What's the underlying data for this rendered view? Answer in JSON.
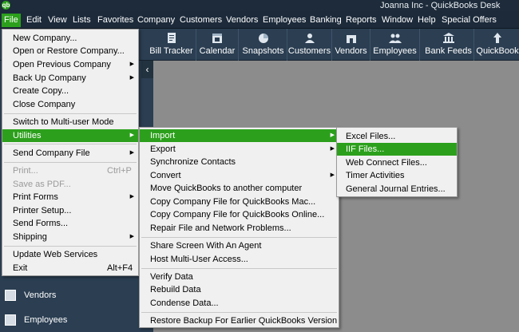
{
  "window": {
    "title": "Joanna Inc  -  QuickBooks Desk",
    "logo": "qb"
  },
  "menubar": {
    "items": [
      "File",
      "Edit",
      "View",
      "Lists",
      "Favorites",
      "Company",
      "Customers",
      "Vendors",
      "Employees",
      "Banking",
      "Reports",
      "Window",
      "Help",
      "Special Offers"
    ]
  },
  "iconbar": {
    "items": [
      {
        "label": "Bill Tracker",
        "icon": "bill-tracker-icon"
      },
      {
        "label": "Calendar",
        "icon": "calendar-icon"
      },
      {
        "label": "Snapshots",
        "icon": "pie-chart-icon"
      },
      {
        "label": "Customers",
        "icon": "customers-icon"
      },
      {
        "label": "Vendors",
        "icon": "vendors-icon"
      },
      {
        "label": "Employees",
        "icon": "employees-icon"
      },
      {
        "label": "Bank Feeds",
        "icon": "bank-icon"
      },
      {
        "label": "QuickBook",
        "icon": "arrow-up-icon"
      }
    ]
  },
  "leftpanel": {
    "collapse": "‹",
    "items": [
      {
        "label": "Vendors",
        "icon": "vendors-icon"
      },
      {
        "label": "Employees",
        "icon": "employees-icon"
      }
    ]
  },
  "file_menu": {
    "items": [
      {
        "label": "New Company...",
        "shortcut": "",
        "arrow": false,
        "disabled": false,
        "hl": false
      },
      {
        "label": "Open or Restore Company...",
        "shortcut": "",
        "arrow": false,
        "disabled": false,
        "hl": false
      },
      {
        "label": "Open Previous Company",
        "shortcut": "",
        "arrow": true,
        "disabled": false,
        "hl": false
      },
      {
        "label": "Back Up Company",
        "shortcut": "",
        "arrow": true,
        "disabled": false,
        "hl": false
      },
      {
        "label": "Create Copy...",
        "shortcut": "",
        "arrow": false,
        "disabled": false,
        "hl": false
      },
      {
        "label": "Close Company",
        "shortcut": "",
        "arrow": false,
        "disabled": false,
        "hl": false
      },
      {
        "label": "Switch to Multi-user Mode",
        "shortcut": "",
        "arrow": false,
        "disabled": false,
        "hl": false
      },
      {
        "label": "Utilities",
        "shortcut": "",
        "arrow": true,
        "disabled": false,
        "hl": true
      },
      {
        "label": "Send Company File",
        "shortcut": "",
        "arrow": true,
        "disabled": false,
        "hl": false
      },
      {
        "label": "Print...",
        "shortcut": "Ctrl+P",
        "arrow": false,
        "disabled": true,
        "hl": false
      },
      {
        "label": "Save as PDF...",
        "shortcut": "",
        "arrow": false,
        "disabled": true,
        "hl": false
      },
      {
        "label": "Print Forms",
        "shortcut": "",
        "arrow": true,
        "disabled": false,
        "hl": false
      },
      {
        "label": "Printer Setup...",
        "shortcut": "",
        "arrow": false,
        "disabled": false,
        "hl": false
      },
      {
        "label": "Send Forms...",
        "shortcut": "",
        "arrow": false,
        "disabled": false,
        "hl": false
      },
      {
        "label": "Shipping",
        "shortcut": "",
        "arrow": true,
        "disabled": false,
        "hl": false
      },
      {
        "label": "Update Web Services",
        "shortcut": "",
        "arrow": false,
        "disabled": false,
        "hl": false
      },
      {
        "label": "Exit",
        "shortcut": "Alt+F4",
        "arrow": false,
        "disabled": false,
        "hl": false
      }
    ]
  },
  "utilities_menu": {
    "items": [
      {
        "label": "Import",
        "arrow": true,
        "hl": true
      },
      {
        "label": "Export",
        "arrow": true,
        "hl": false
      },
      {
        "label": "Synchronize Contacts",
        "arrow": false,
        "hl": false
      },
      {
        "label": "Convert",
        "arrow": true,
        "hl": false
      },
      {
        "label": "Move QuickBooks to another computer",
        "arrow": false,
        "hl": false
      },
      {
        "label": "Copy Company File for QuickBooks Mac...",
        "arrow": false,
        "hl": false
      },
      {
        "label": "Copy Company File for QuickBooks Online...",
        "arrow": false,
        "hl": false
      },
      {
        "label": "Repair File and Network Problems...",
        "arrow": false,
        "hl": false
      },
      {
        "label": "Share Screen With An Agent",
        "arrow": false,
        "hl": false
      },
      {
        "label": "Host Multi-User Access...",
        "arrow": false,
        "hl": false
      },
      {
        "label": "Verify Data",
        "arrow": false,
        "hl": false
      },
      {
        "label": "Rebuild Data",
        "arrow": false,
        "hl": false
      },
      {
        "label": "Condense Data...",
        "arrow": false,
        "hl": false
      },
      {
        "label": "Restore Backup For Earlier QuickBooks Version",
        "arrow": false,
        "hl": false
      }
    ]
  },
  "import_menu": {
    "items": [
      {
        "label": "Excel Files...",
        "hl": false
      },
      {
        "label": "IIF Files...",
        "hl": true
      },
      {
        "label": "Web Connect Files...",
        "hl": false
      },
      {
        "label": "Timer Activities",
        "hl": false
      },
      {
        "label": "General Journal Entries...",
        "hl": false
      }
    ]
  },
  "colors": {
    "accent": "#2ca01c",
    "chrome": "#1c2a3a",
    "iconbar": "#2b3e52",
    "workspace": "#8c8c8c",
    "menu_bg": "#f0f0f0"
  }
}
